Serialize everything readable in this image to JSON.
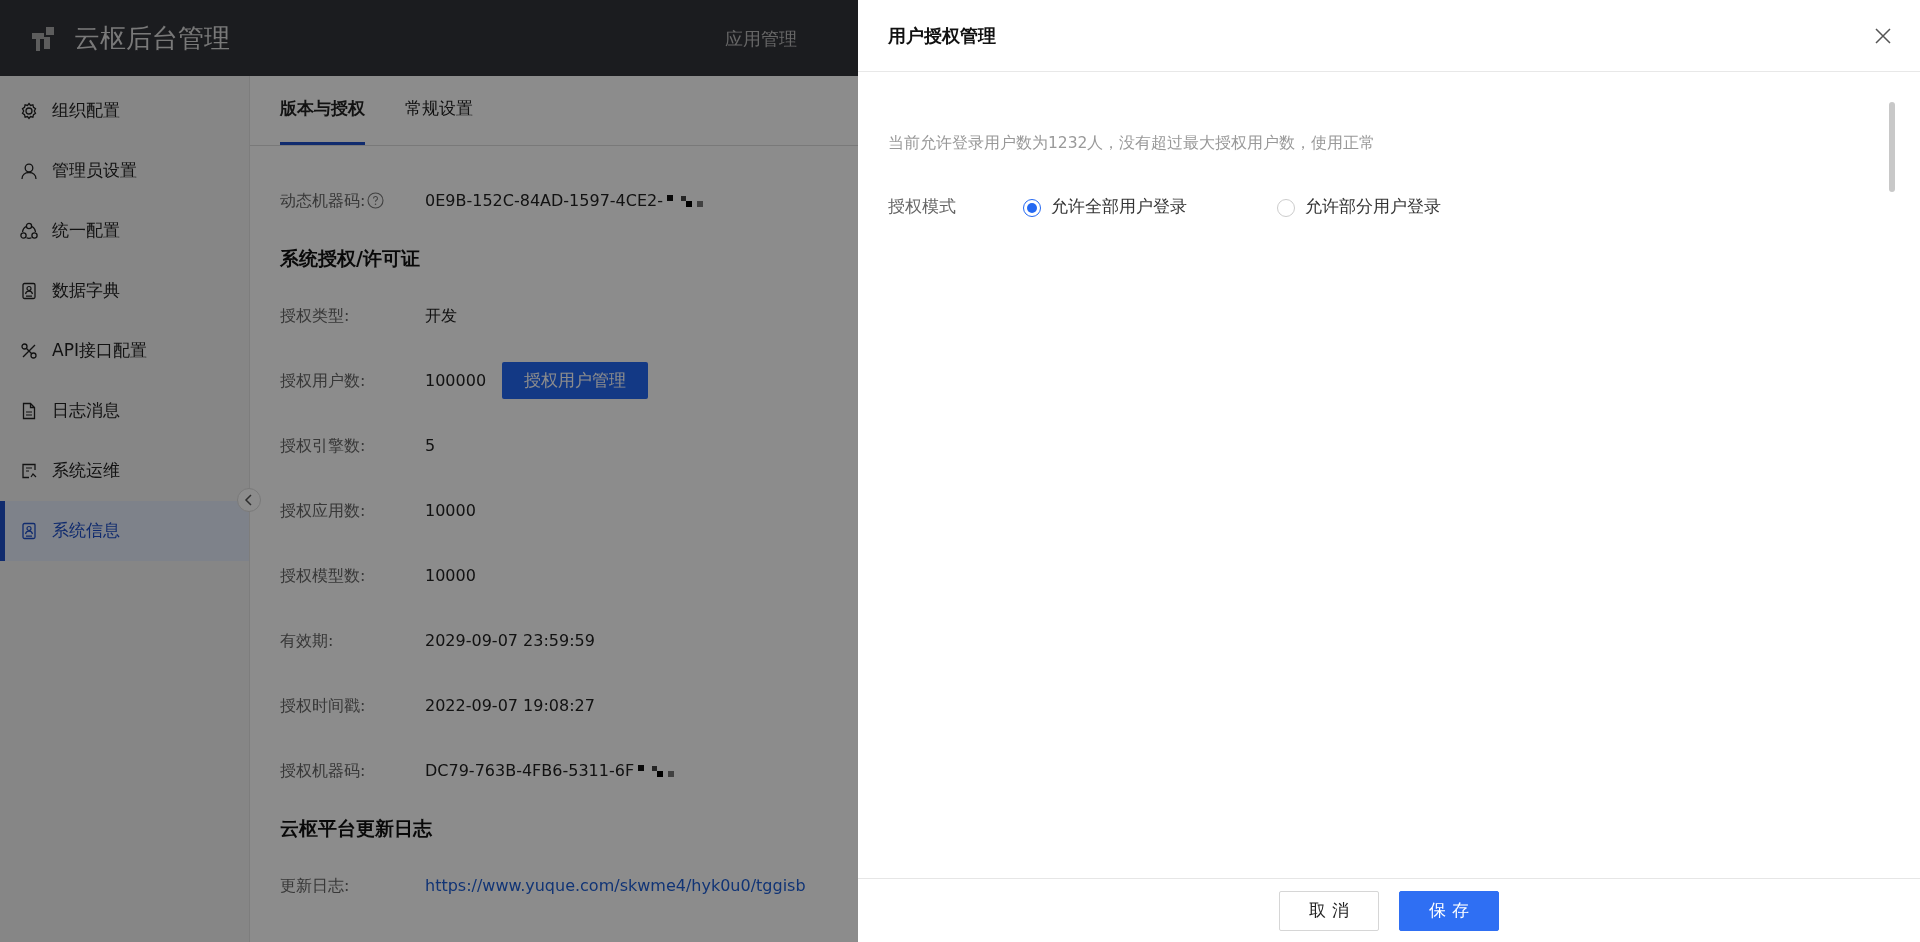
{
  "header": {
    "title": "云枢后台管理",
    "nav": [
      {
        "label": "应用管理"
      }
    ]
  },
  "sidebar": {
    "items": [
      {
        "label": "组织配置",
        "kind": "gear",
        "selected": false
      },
      {
        "label": "管理员设置",
        "kind": "user",
        "selected": false
      },
      {
        "label": "统一配置",
        "kind": "nodes",
        "selected": false
      },
      {
        "label": "数据字典",
        "kind": "card",
        "selected": false
      },
      {
        "label": "API接口配置",
        "kind": "tools",
        "selected": false
      },
      {
        "label": "日志消息",
        "kind": "doc",
        "selected": false
      },
      {
        "label": "系统运维",
        "kind": "ticket",
        "selected": false
      },
      {
        "label": "系统信息",
        "kind": "card",
        "selected": true
      }
    ]
  },
  "tabs": [
    {
      "label": "版本与授权",
      "selected": true
    },
    {
      "label": "常规设置",
      "selected": false
    }
  ],
  "content": [
    {
      "kind": "field",
      "label": "动态机器码:",
      "value": "0E9B-152C-84AD-1597-4CE2-",
      "help": true,
      "redacted": true
    },
    {
      "kind": "heading",
      "label": "系统授权/许可证"
    },
    {
      "kind": "field",
      "label": "授权类型:",
      "value": "开发"
    },
    {
      "kind": "field",
      "label": "授权用户数:",
      "value": "100000",
      "button": "授权用户管理"
    },
    {
      "kind": "field",
      "label": "授权引擎数:",
      "value": "5"
    },
    {
      "kind": "field",
      "label": "授权应用数:",
      "value": "10000"
    },
    {
      "kind": "field",
      "label": "授权模型数:",
      "value": "10000"
    },
    {
      "kind": "field",
      "label": "有效期:",
      "value": "2029-09-07 23:59:59"
    },
    {
      "kind": "field",
      "label": "授权时间戳:",
      "value": "2022-09-07 19:08:27"
    },
    {
      "kind": "field",
      "label": "授权机器码:",
      "value": "DC79-763B-4FB6-5311-6F",
      "redacted": true
    },
    {
      "kind": "heading",
      "label": "云枢平台更新日志"
    },
    {
      "kind": "link",
      "label": "更新日志:",
      "value": "https://www.yuque.com/skwme4/hyk0u0/tggisb"
    }
  ],
  "drawer": {
    "title": "用户授权管理",
    "notice": "当前允许登录用户数为1232人，没有超过最大授权用户数，使用正常",
    "mode_label": "授权模式",
    "options": [
      {
        "label": "允许全部用户登录",
        "selected": true
      },
      {
        "label": "允许部分用户登录",
        "selected": false
      }
    ],
    "buttons": [
      {
        "label": "取 消",
        "kind": "secondary"
      },
      {
        "label": "保 存",
        "kind": "primary"
      }
    ]
  }
}
